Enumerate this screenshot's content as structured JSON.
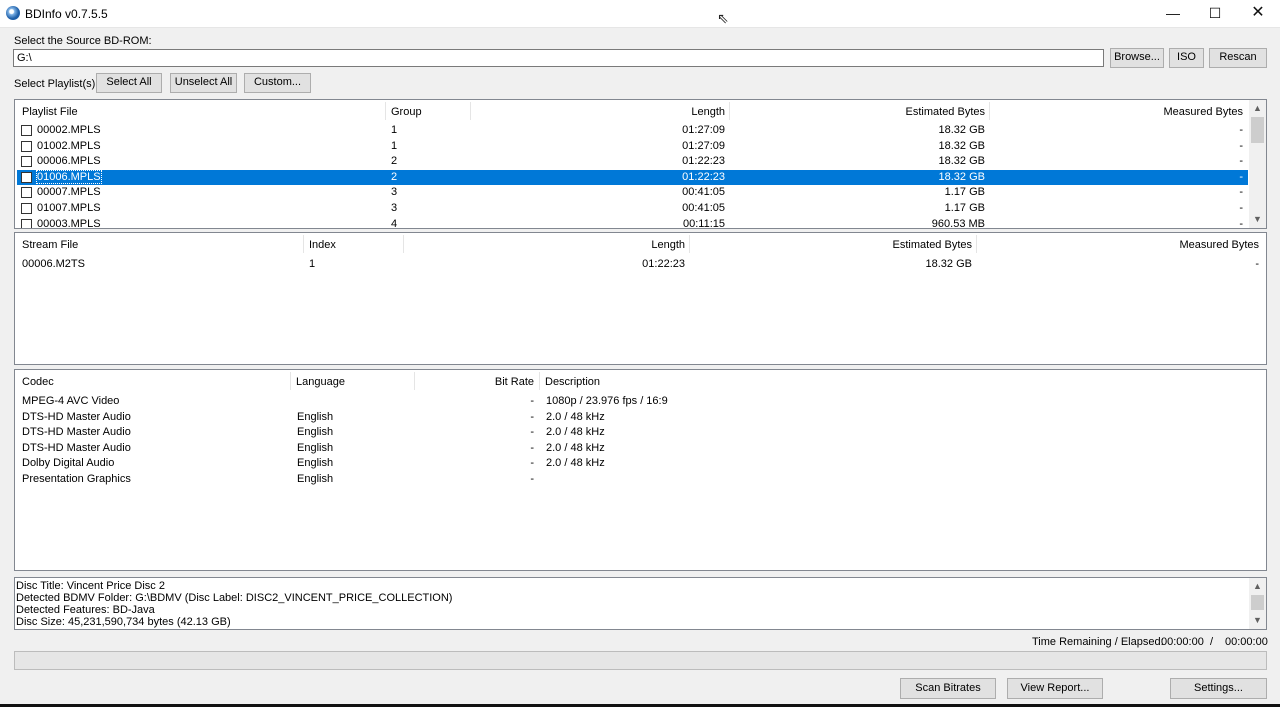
{
  "window": {
    "title": "BDInfo v0.7.5.5",
    "minimize_label": "—",
    "maximize_label": "☐",
    "close_label": "✕"
  },
  "source": {
    "label": "Select the Source BD-ROM:",
    "path_value": "G:\\",
    "browse_label": "Browse...",
    "iso_label": "ISO",
    "rescan_label": "Rescan"
  },
  "playlist_controls": {
    "label": "Select Playlist(s):",
    "select_all_label": "Select All",
    "unselect_all_label": "Unselect All",
    "custom_label": "Custom..."
  },
  "playlists": {
    "headers": [
      "Playlist File",
      "Group",
      "Length",
      "Estimated Bytes",
      "Measured Bytes"
    ],
    "rows": [
      {
        "file": "00002.MPLS",
        "group": "1",
        "length": "01:27:09",
        "estimated": "18.32 GB",
        "measured": "-",
        "checked": false,
        "selected": false
      },
      {
        "file": "01002.MPLS",
        "group": "1",
        "length": "01:27:09",
        "estimated": "18.32 GB",
        "measured": "-",
        "checked": false,
        "selected": false
      },
      {
        "file": "00006.MPLS",
        "group": "2",
        "length": "01:22:23",
        "estimated": "18.32 GB",
        "measured": "-",
        "checked": false,
        "selected": false
      },
      {
        "file": "01006.MPLS",
        "group": "2",
        "length": "01:22:23",
        "estimated": "18.32 GB",
        "measured": "-",
        "checked": false,
        "selected": true
      },
      {
        "file": "00007.MPLS",
        "group": "3",
        "length": "00:41:05",
        "estimated": "1.17 GB",
        "measured": "-",
        "checked": false,
        "selected": false
      },
      {
        "file": "01007.MPLS",
        "group": "3",
        "length": "00:41:05",
        "estimated": "1.17 GB",
        "measured": "-",
        "checked": false,
        "selected": false
      },
      {
        "file": "00003.MPLS",
        "group": "4",
        "length": "00:11:15",
        "estimated": "960.53 MB",
        "measured": "-",
        "checked": false,
        "selected": false
      }
    ]
  },
  "streams": {
    "headers": [
      "Stream File",
      "Index",
      "Length",
      "Estimated Bytes",
      "Measured Bytes"
    ],
    "rows": [
      {
        "file": "00006.M2TS",
        "index": "1",
        "length": "01:22:23",
        "estimated": "18.32 GB",
        "measured": "-"
      }
    ]
  },
  "codecs": {
    "headers": [
      "Codec",
      "Language",
      "Bit Rate",
      "Description"
    ],
    "rows": [
      {
        "codec": "MPEG-4 AVC Video",
        "language": "",
        "bitrate": "-",
        "description": "1080p / 23.976 fps / 16:9"
      },
      {
        "codec": "DTS-HD Master Audio",
        "language": "English",
        "bitrate": "-",
        "description": "2.0 / 48 kHz"
      },
      {
        "codec": "DTS-HD Master Audio",
        "language": "English",
        "bitrate": "-",
        "description": "2.0 / 48 kHz"
      },
      {
        "codec": "DTS-HD Master Audio",
        "language": "English",
        "bitrate": "-",
        "description": "2.0 / 48 kHz"
      },
      {
        "codec": "Dolby Digital Audio",
        "language": "English",
        "bitrate": "-",
        "description": "2.0 / 48 kHz"
      },
      {
        "codec": "Presentation Graphics",
        "language": "English",
        "bitrate": "-",
        "description": ""
      }
    ]
  },
  "disc_info": {
    "lines": [
      "Disc Title: Vincent Price Disc 2",
      "Detected BDMV Folder: G:\\BDMV (Disc Label: DISC2_VINCENT_PRICE_COLLECTION)",
      "Detected Features: BD-Java",
      "Disc Size: 45,231,590,734 bytes (42.13 GB)"
    ]
  },
  "status": {
    "time_label": "Time Remaining / Elapsed:",
    "remaining": "00:00:00",
    "separator": "/",
    "elapsed": "00:00:00",
    "progress_fraction": 0
  },
  "actions": {
    "scan_label": "Scan Bitrates",
    "report_label": "View Report...",
    "settings_label": "Settings..."
  }
}
